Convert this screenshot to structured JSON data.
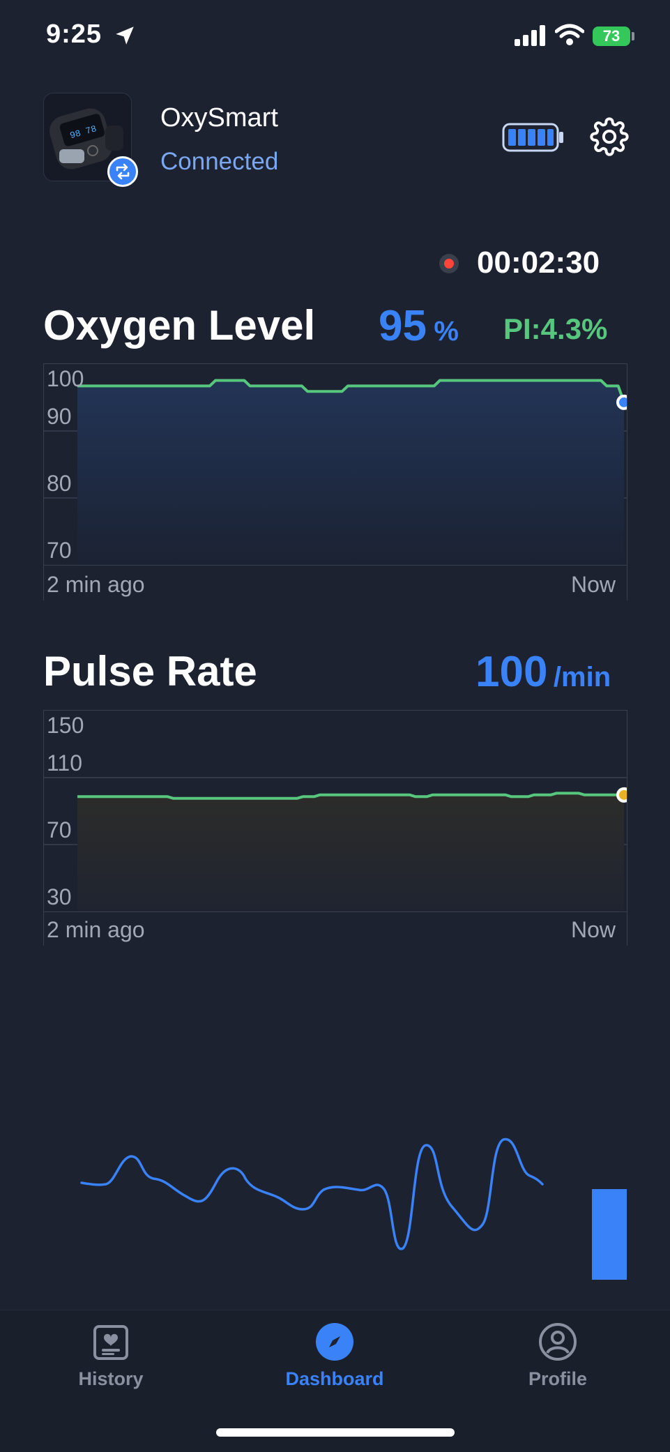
{
  "status_bar": {
    "time": "9:25",
    "battery": "73"
  },
  "device": {
    "name": "OxySmart",
    "status": "Connected"
  },
  "recording": {
    "timer": "00:02:30"
  },
  "oxygen": {
    "title": "Oxygen Level",
    "value": "95",
    "unit": "%",
    "pi": "PI:4.3%",
    "y_ticks": [
      "100",
      "90",
      "80",
      "70"
    ],
    "x_start": "2 min ago",
    "x_end": "Now"
  },
  "pulse": {
    "title": "Pulse Rate",
    "value": "100",
    "unit": "/min",
    "y_ticks": [
      "150",
      "110",
      "70",
      "30"
    ],
    "x_start": "2 min ago",
    "x_end": "Now"
  },
  "nav": {
    "tabs": [
      {
        "label": "History",
        "icon": "history-icon"
      },
      {
        "label": "Dashboard",
        "icon": "dashboard-compass-icon"
      },
      {
        "label": "Profile",
        "icon": "profile-icon"
      }
    ]
  },
  "colors": {
    "accent": "#3a82f7",
    "line": "#58c77e",
    "pi": "#58c77e",
    "background": "#1d2231"
  },
  "chart_data": [
    {
      "type": "area",
      "x_range_labels": [
        "2 min ago",
        "Now"
      ],
      "ylim": [
        65,
        102
      ],
      "y_ticks": [
        100,
        90,
        80,
        70
      ],
      "series": [
        {
          "values": [
            98,
            98,
            98,
            98,
            98,
            98,
            98,
            98,
            98,
            98,
            98,
            98,
            98,
            98,
            98,
            98,
            98,
            98,
            98,
            98,
            98,
            98,
            98,
            98,
            99,
            99,
            99,
            99,
            99,
            99,
            98,
            98,
            98,
            98,
            98,
            98,
            98,
            98,
            98,
            98,
            97,
            97,
            97,
            97,
            97,
            97,
            97,
            98,
            98,
            98,
            98,
            98,
            98,
            98,
            98,
            98,
            98,
            98,
            98,
            98,
            98,
            98,
            98,
            99,
            99,
            99,
            99,
            99,
            99,
            99,
            99,
            99,
            99,
            99,
            99,
            99,
            99,
            99,
            99,
            99,
            99,
            99,
            99,
            99,
            99,
            99,
            99,
            99,
            99,
            99,
            99,
            99,
            98,
            98,
            98,
            95
          ]
        }
      ]
    },
    {
      "type": "area",
      "x_range_labels": [
        "2 min ago",
        "Now"
      ],
      "ylim": [
        30,
        150
      ],
      "y_ticks": [
        150,
        110,
        70,
        30
      ],
      "series": [
        {
          "values": [
            99,
            99,
            99,
            99,
            99,
            99,
            99,
            99,
            99,
            99,
            99,
            99,
            99,
            99,
            99,
            99,
            99,
            98,
            98,
            98,
            98,
            98,
            98,
            98,
            98,
            98,
            98,
            98,
            98,
            98,
            98,
            98,
            98,
            98,
            98,
            98,
            98,
            98,
            98,
            98,
            99,
            99,
            99,
            100,
            100,
            100,
            100,
            100,
            100,
            100,
            100,
            100,
            100,
            100,
            100,
            100,
            100,
            100,
            100,
            100,
            99,
            99,
            99,
            100,
            100,
            100,
            100,
            100,
            100,
            100,
            100,
            100,
            100,
            100,
            100,
            100,
            100,
            99,
            99,
            99,
            99,
            100,
            100,
            100,
            100,
            101,
            101,
            101,
            101,
            101,
            100,
            100,
            100,
            100,
            100,
            100,
            100,
            100
          ]
        }
      ]
    }
  ]
}
